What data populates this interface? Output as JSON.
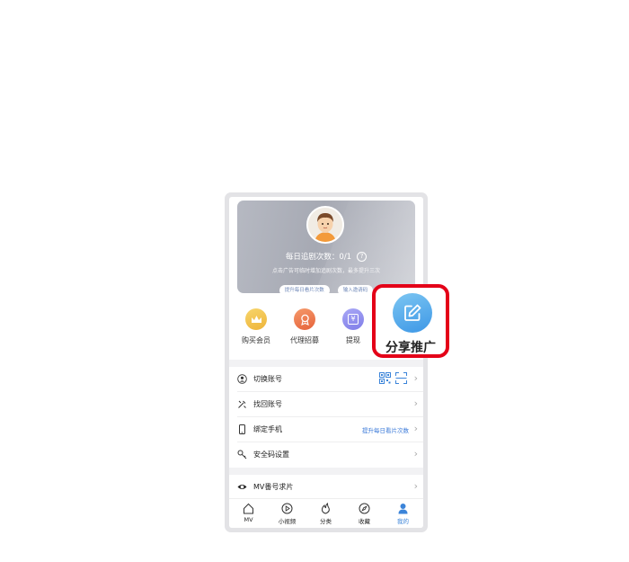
{
  "profile": {
    "stat_label": "每日追剧次数：0/1",
    "help_mark": "?",
    "hint": "点击广告可临时增加追剧次数，最多提升三次",
    "buttons": [
      "提升每日看片次数",
      "输入邀请码"
    ]
  },
  "shortcuts": [
    {
      "label": "购买会员",
      "icon": "crown-icon",
      "color": "#f0c04a"
    },
    {
      "label": "代理招募",
      "icon": "medal-icon",
      "color": "#ee7b4e"
    },
    {
      "label": "提现",
      "icon": "yuan-icon",
      "color": "#8f8ef0",
      "glyph": "¥"
    }
  ],
  "menu": [
    {
      "label": "切换账号",
      "icon": "user-circle-icon"
    },
    {
      "label": "找回账号",
      "icon": "tools-icon"
    },
    {
      "label": "绑定手机",
      "icon": "phone-icon",
      "extra": "提升每日看片次数"
    },
    {
      "label": "安全码设置",
      "icon": "key-icon"
    },
    {
      "label": "MV番号求片",
      "icon": "eye-icon"
    }
  ],
  "chevron": "›",
  "tabs": [
    {
      "label": "MV",
      "icon": "home-icon"
    },
    {
      "label": "小视频",
      "icon": "play-icon"
    },
    {
      "label": "分类",
      "icon": "flame-icon"
    },
    {
      "label": "收藏",
      "icon": "compass-icon"
    },
    {
      "label": "我的",
      "icon": "person-icon",
      "active": true
    }
  ],
  "callout": {
    "label": "分享推广",
    "icon": "edit-icon"
  },
  "colors": {
    "accent": "#3b84d9",
    "highlight": "#e40018"
  }
}
